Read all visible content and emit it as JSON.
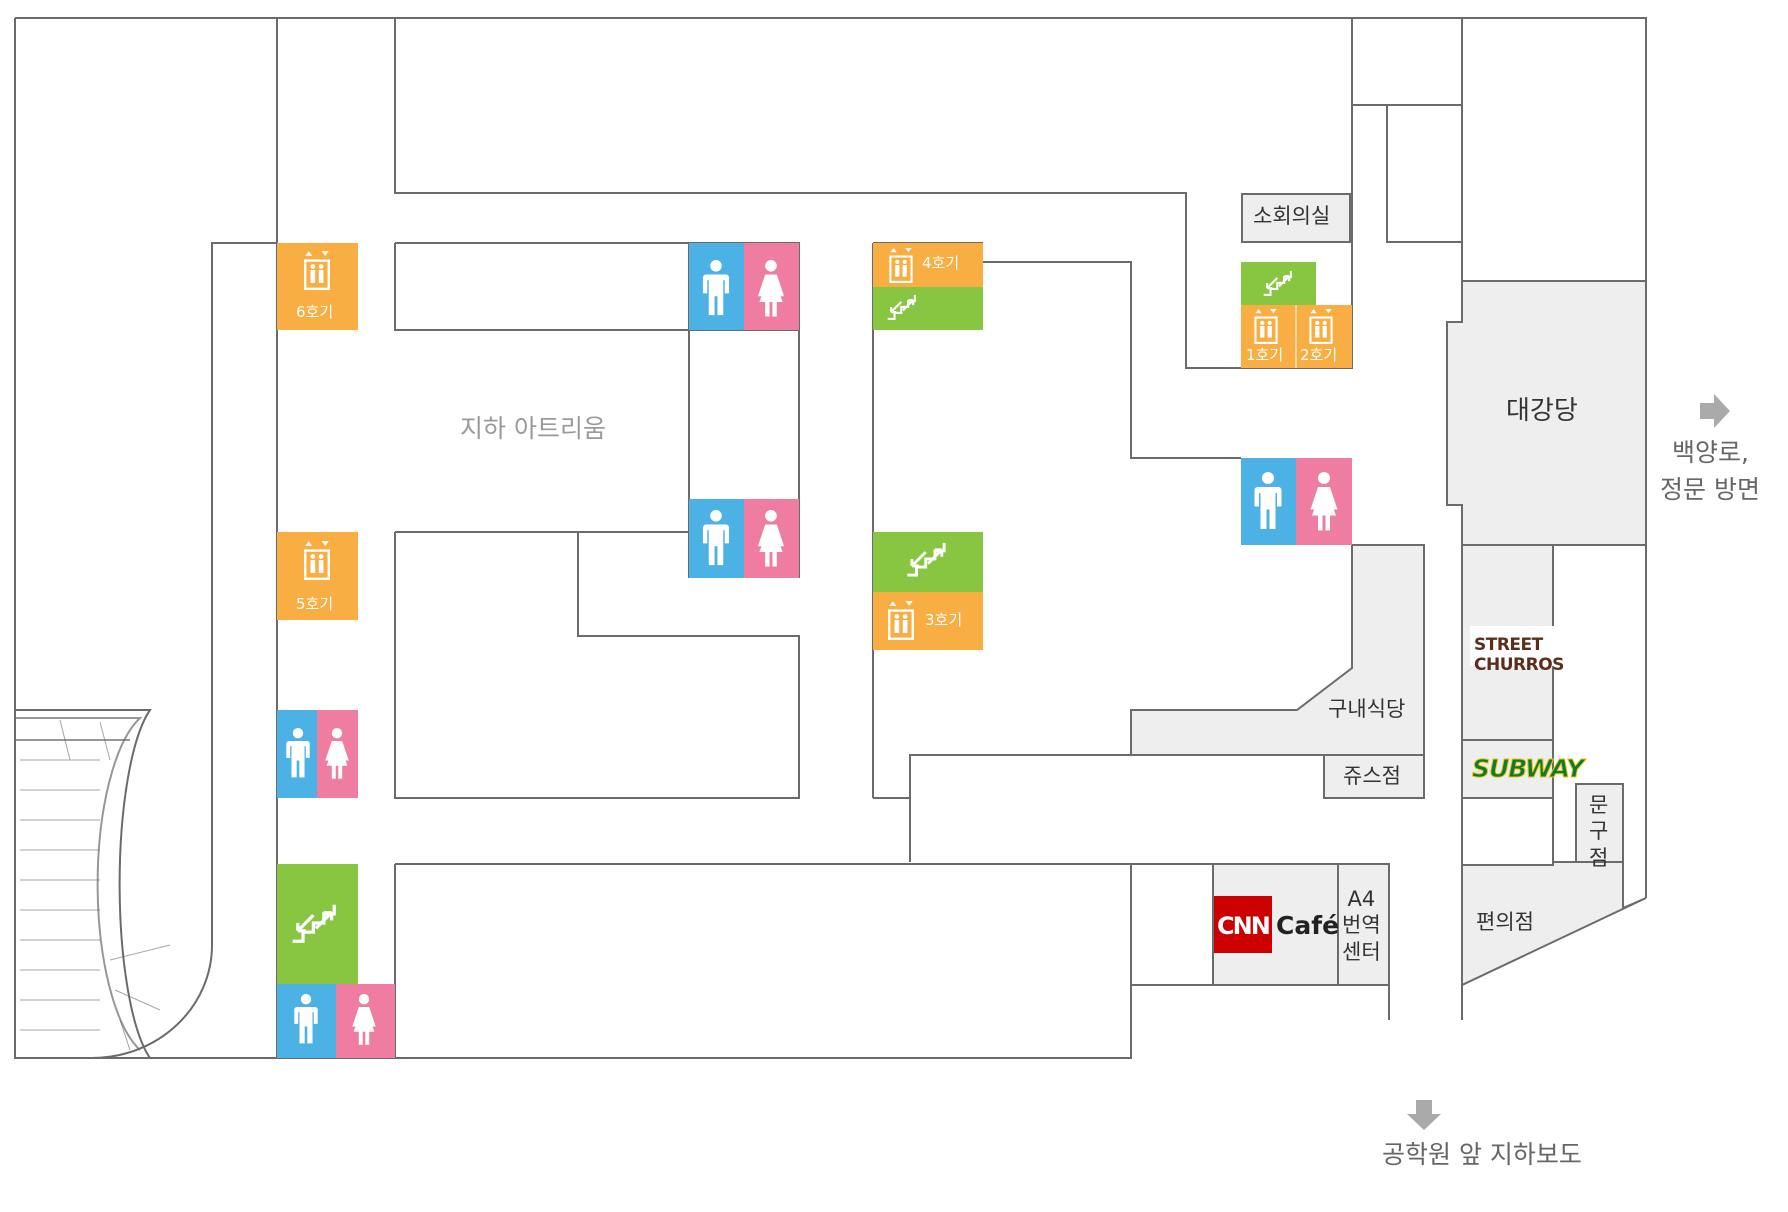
{
  "colors": {
    "elevator": "#f8ae42",
    "stairs": "#88c540",
    "men": "#4cb1e4",
    "women": "#ef7da2",
    "facility_fill": "#eeeeee",
    "wall": "#6b6b6b",
    "text": "#333333",
    "hint_text": "#9a9a9a"
  },
  "areas": {
    "atrium": "지하 아트리움",
    "meeting_room": "소회의실",
    "auditorium": "대강당",
    "cafeteria": "구내식당",
    "juice_shop": "쥬스점",
    "convenience_store": "편의점",
    "stationery_store": "문구점",
    "stationery_store_lines": [
      "문",
      "구",
      "점"
    ],
    "translation_center_lines": [
      "A4",
      "번역",
      "센터"
    ]
  },
  "elevators": {
    "e1": "1호기",
    "e2": "2호기",
    "e3": "3호기",
    "e4": "4호기",
    "e5": "5호기",
    "e6": "6호기"
  },
  "icons": {
    "elevator": "elevator-icon",
    "stairs": "stairs-icon",
    "men": "man-restroom-icon",
    "women": "woman-restroom-icon",
    "direction": "arrow-icon"
  },
  "shops": {
    "street_churros": "STREET CHURROS",
    "subway": "SUBWAY",
    "cnn_cafe_brand": "CNN",
    "cnn_cafe_word": "Café"
  },
  "exits": {
    "east_line1": "백양로,",
    "east_line2": "정문 방면",
    "south": "공학원 앞 지하보도"
  }
}
